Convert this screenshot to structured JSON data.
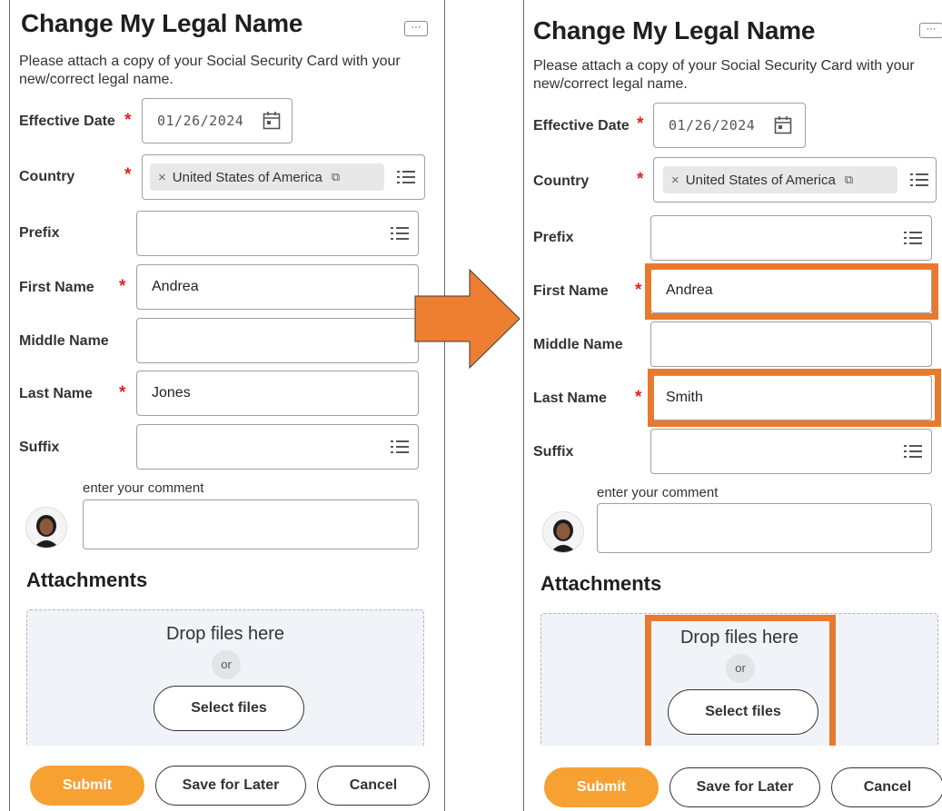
{
  "form": {
    "title": "Change My Legal Name",
    "more_label": "···",
    "instructions": "Please attach a copy of your Social Security Card with your new/correct legal name.",
    "required_mark": "*",
    "labels": {
      "effective_date": "Effective Date",
      "country": "Country",
      "prefix": "Prefix",
      "first_name": "First Name",
      "middle_name": "Middle Name",
      "last_name": "Last Name",
      "suffix": "Suffix"
    },
    "effective_date_value": "01/26/2024",
    "country_value": "United States of America",
    "pill_remove": "×",
    "pill_external": "⧉",
    "comment_label": "enter your comment",
    "attachments_title": "Attachments",
    "drop_text": "Drop files here",
    "or_text": "or",
    "select_files": "Select files",
    "submit": "Submit",
    "save_for_later": "Save for Later",
    "cancel": "Cancel"
  },
  "before": {
    "first_name": "Andrea",
    "last_name": "Jones"
  },
  "after": {
    "first_name": "Andrea",
    "last_name": "Smith"
  },
  "colors": {
    "arrow": "#ee7f30",
    "highlight": "#e87a2f",
    "submit": "#f7a132",
    "required": "#e4211b"
  },
  "icons": {
    "calendar": "calendar-icon",
    "list": "list-icon",
    "arrow": "right-arrow-icon"
  }
}
